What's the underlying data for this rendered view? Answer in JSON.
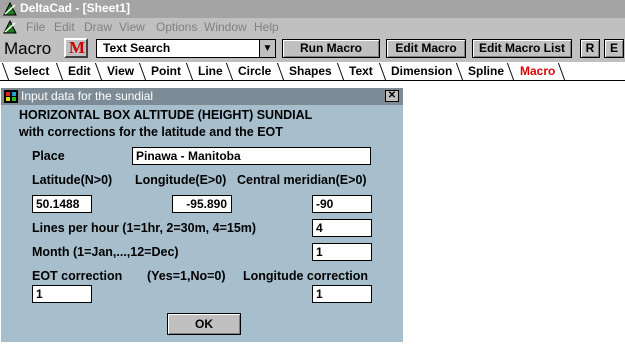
{
  "app": {
    "title": "DeltaCad - [Sheet1]"
  },
  "menu": [
    "File",
    "Edit",
    "Draw",
    "View",
    "Options",
    "Window",
    "Help"
  ],
  "toolbar": {
    "macro_label": "Macro",
    "macro_icon_letter": "M",
    "macro_select_value": "Text Search",
    "run_macro": "Run Macro",
    "edit_macro": "Edit Macro",
    "edit_macro_list": "Edit Macro List",
    "r_button": "R",
    "e_button": "E"
  },
  "tabs": [
    "Select",
    "Edit",
    "View",
    "Point",
    "Line",
    "Circle",
    "Shapes",
    "Text",
    "Dimension",
    "Spline",
    "Macro"
  ],
  "active_tab": "Macro",
  "dialog": {
    "title": "Input data for the sundial",
    "heading_line1": "HORIZONTAL BOX ALTITUDE (HEIGHT) SUNDIAL",
    "heading_line2": "with corrections for the latitude and the EOT",
    "place_label": "Place",
    "place_value": "Pinawa - Manitoba",
    "latitude_label": "Latitude(N>0)",
    "longitude_label": "Longitude(E>0)",
    "central_meridian_label": "Central meridian(E>0)",
    "latitude_value": "50.1488",
    "longitude_value": "-95.890",
    "central_meridian_value": "-90",
    "lines_label": "Lines per hour (1=1hr, 2=30m, 4=15m)",
    "lines_value": "4",
    "month_label": "Month (1=Jan,...,12=Dec)",
    "month_value": "1",
    "eot_label": "EOT correction",
    "yesno_label": "(Yes=1,No=0)",
    "longitude_correction_label": "Longitude correction",
    "eot_value": "1",
    "longitude_correction_value": "1",
    "ok_label": "OK",
    "close_glyph": "✕"
  }
}
